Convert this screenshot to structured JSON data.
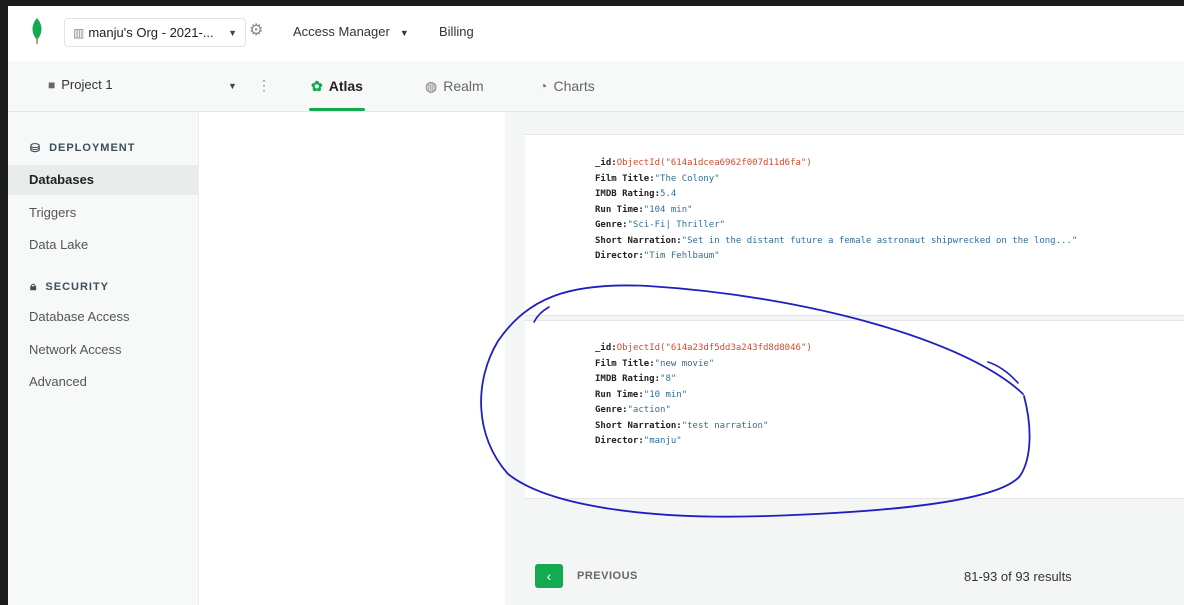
{
  "topbar": {
    "org_name": "manju's Org - 2021-...",
    "access_manager": "Access Manager",
    "billing": "Billing"
  },
  "project": {
    "name": "Project 1"
  },
  "tabs": [
    {
      "label": "Atlas",
      "icon": "atlas-icon",
      "active": true
    },
    {
      "label": "Realm",
      "icon": "realm-icon",
      "active": false
    },
    {
      "label": "Charts",
      "icon": "charts-icon",
      "active": false
    }
  ],
  "sidebar": {
    "deployment_title": "DEPLOYMENT",
    "deployment_items": [
      "Databases",
      "Triggers",
      "Data Lake"
    ],
    "security_title": "SECURITY",
    "security_items": [
      "Database Access",
      "Network Access",
      "Advanced"
    ]
  },
  "documents": [
    {
      "fields": [
        {
          "key": "_id",
          "value": "ObjectId(\"614a1dcea6962f007d11d6fa\")",
          "is_id": true
        },
        {
          "key": "Film Title",
          "value": "\"The Colony\""
        },
        {
          "key": "IMDB Rating",
          "value": "5.4"
        },
        {
          "key": "Run Time",
          "value": "\"104 min\""
        },
        {
          "key": "Genre",
          "value": "\"Sci-Fi| Thriller\""
        },
        {
          "key": "Short Narration",
          "value": "\"Set in the distant future  a female astronaut  shipwrecked on the long...\""
        },
        {
          "key": "Director",
          "value": "\"Tim Fehlbaum\""
        }
      ]
    },
    {
      "fields": [
        {
          "key": "_id",
          "value": "ObjectId(\"614a23df5dd3a243fd8d8046\")",
          "is_id": true
        },
        {
          "key": "Film Title",
          "value": "\"new movie\""
        },
        {
          "key": "IMDB Rating",
          "value": "\"8\""
        },
        {
          "key": "Run Time",
          "value": "\"10 min\""
        },
        {
          "key": "Genre",
          "value": "\"action\""
        },
        {
          "key": "Short Narration",
          "value": "\"test narration\""
        },
        {
          "key": "Director",
          "value": "\"manju\""
        }
      ]
    }
  ],
  "pagination": {
    "previous_label": "PREVIOUS",
    "results": "81-93 of 93 results"
  },
  "colors": {
    "brand_green": "#13aa52",
    "annotation_ink": "#1f1fbf",
    "id_value": "#d14a2c",
    "string_value": "#2f6f9a"
  }
}
